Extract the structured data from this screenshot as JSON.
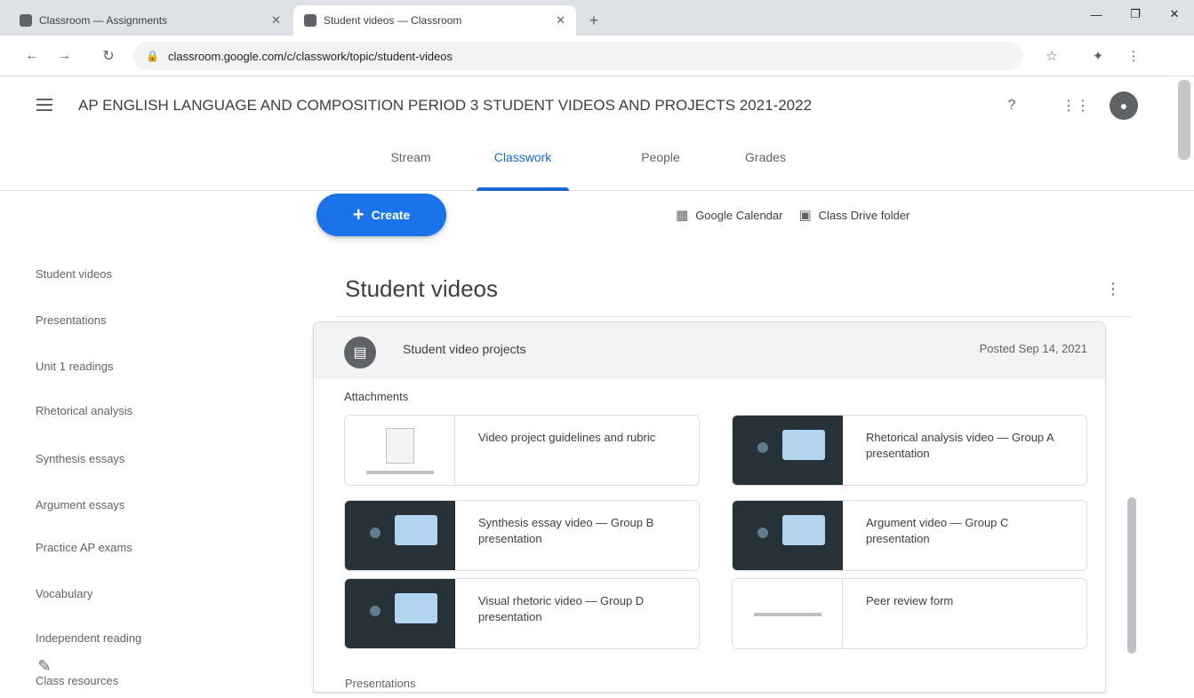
{
  "browser": {
    "tabs": [
      {
        "title": "Classroom — Assignments"
      },
      {
        "title": "Student videos — Classroom"
      }
    ],
    "url": "classroom.google.com/c/classwork/topic/student-videos",
    "window_controls": [
      "—",
      "❐",
      "✕"
    ]
  },
  "header": {
    "class_title": "AP ENGLISH LANGUAGE AND COMPOSITION PERIOD 3 STUDENT VIDEOS AND PROJECTS 2021-2022"
  },
  "class_tabs": [
    "Stream",
    "Classwork",
    "People",
    "Grades"
  ],
  "sidebar": {
    "items": [
      "Student videos",
      "Presentations",
      "Unit 1 readings",
      "Rhetorical analysis",
      "Synthesis essays",
      "Argument essays",
      "Practice AP exams",
      "Vocabulary",
      "Independent reading",
      "Class resources"
    ]
  },
  "toolbar": {
    "create_label": "Create",
    "calendar_label": "Google Calendar",
    "drive_label": "Class Drive folder"
  },
  "topic": {
    "title": "Student videos"
  },
  "material": {
    "title": "Student video projects",
    "date": "Posted Sep 14, 2021",
    "attachments_label": "Attachments",
    "attachments": [
      {
        "name": "Video project guidelines and rubric",
        "kind": "doc"
      },
      {
        "name": "Rhetorical analysis video — Group A presentation",
        "kind": "video"
      },
      {
        "name": "Synthesis essay video — Group B presentation",
        "kind": "video"
      },
      {
        "name": "Argument video — Group C presentation",
        "kind": "video"
      },
      {
        "name": "Visual rhetoric video — Group D presentation",
        "kind": "video"
      },
      {
        "name": "Peer review form",
        "kind": "doc"
      }
    ]
  },
  "next_topic_label": "Presentations"
}
